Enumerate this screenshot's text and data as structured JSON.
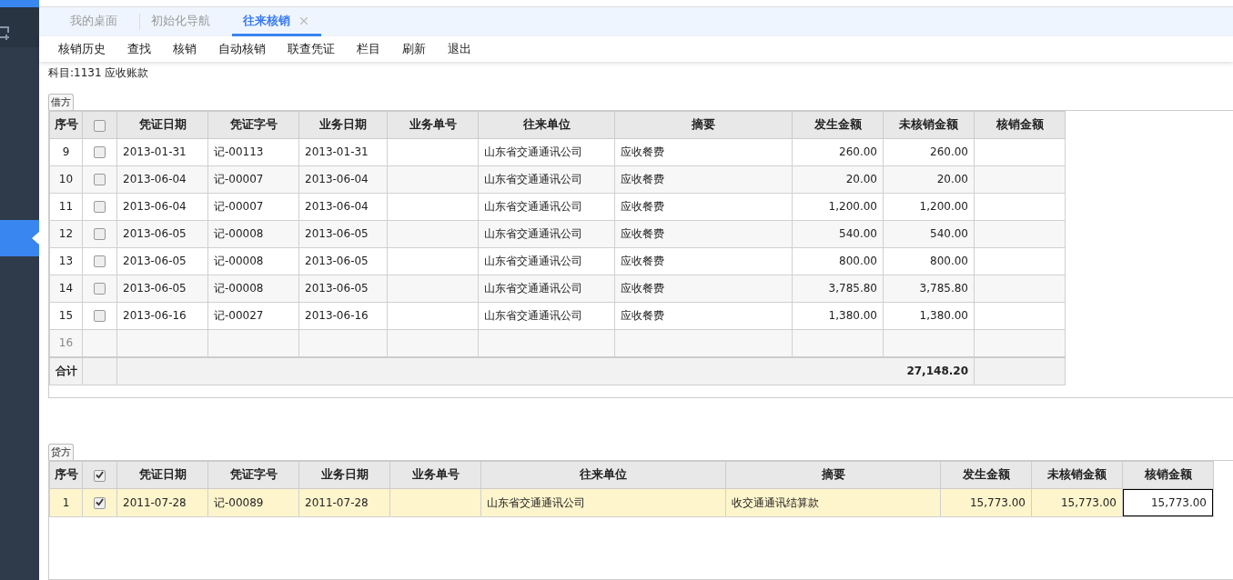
{
  "tabs": [
    {
      "label": "我的桌面",
      "selected": false
    },
    {
      "label": "初始化导航",
      "selected": false
    },
    {
      "label": "往来核销",
      "selected": true
    }
  ],
  "toolbar": [
    "核销历史",
    "查找",
    "核销",
    "自动核销",
    "联查凭证",
    "栏目",
    "刷新",
    "退出"
  ],
  "subject": "科目:1131 应收账款",
  "debit": {
    "label": "借方",
    "header_checked": false,
    "columns": [
      "序号",
      "",
      "凭证日期",
      "凭证字号",
      "业务日期",
      "业务单号",
      "往来单位",
      "摘要",
      "发生金额",
      "未核销金额",
      "核销金额"
    ],
    "rows": [
      {
        "checked": false,
        "editing": false,
        "cells": [
          "9",
          "",
          "2013-01-31",
          "记-00113",
          "2013-01-31",
          "",
          "山东省交通通讯公司",
          "应收餐费",
          "260.00",
          "260.00",
          ""
        ]
      },
      {
        "checked": false,
        "editing": false,
        "cells": [
          "10",
          "",
          "2013-06-04",
          "记-00007",
          "2013-06-04",
          "",
          "山东省交通通讯公司",
          "应收餐费",
          "20.00",
          "20.00",
          ""
        ]
      },
      {
        "checked": false,
        "editing": false,
        "cells": [
          "11",
          "",
          "2013-06-04",
          "记-00007",
          "2013-06-04",
          "",
          "山东省交通通讯公司",
          "应收餐费",
          "1,200.00",
          "1,200.00",
          ""
        ]
      },
      {
        "checked": false,
        "editing": false,
        "cells": [
          "12",
          "",
          "2013-06-05",
          "记-00008",
          "2013-06-05",
          "",
          "山东省交通通讯公司",
          "应收餐费",
          "540.00",
          "540.00",
          ""
        ]
      },
      {
        "checked": false,
        "editing": false,
        "cells": [
          "13",
          "",
          "2013-06-05",
          "记-00008",
          "2013-06-05",
          "",
          "山东省交通通讯公司",
          "应收餐费",
          "800.00",
          "800.00",
          ""
        ]
      },
      {
        "checked": false,
        "editing": false,
        "cells": [
          "14",
          "",
          "2013-06-05",
          "记-00008",
          "2013-06-05",
          "",
          "山东省交通通讯公司",
          "应收餐费",
          "3,785.80",
          "3,785.80",
          ""
        ]
      },
      {
        "checked": false,
        "editing": false,
        "cells": [
          "15",
          "",
          "2013-06-16",
          "记-00027",
          "2013-06-16",
          "",
          "山东省交通通讯公司",
          "应收餐费",
          "1,380.00",
          "1,380.00",
          ""
        ]
      }
    ],
    "new_row_number": "16",
    "total_label": "合计",
    "total": "27,148.20"
  },
  "credit": {
    "label": "贷方",
    "header_checked": true,
    "columns": [
      "序号",
      "",
      "凭证日期",
      "凭证字号",
      "业务日期",
      "业务单号",
      "往来单位",
      "摘要",
      "发生金额",
      "未核销金额",
      "核销金额"
    ],
    "rows": [
      {
        "checked": true,
        "editing": true,
        "cells": [
          "1",
          "",
          "2011-07-28",
          "记-00089",
          "2011-07-28",
          "",
          "山东省交通通讯公司",
          "收交通通讯结算款",
          "15,773.00",
          "15,773.00",
          "15,773.00"
        ]
      }
    ]
  }
}
